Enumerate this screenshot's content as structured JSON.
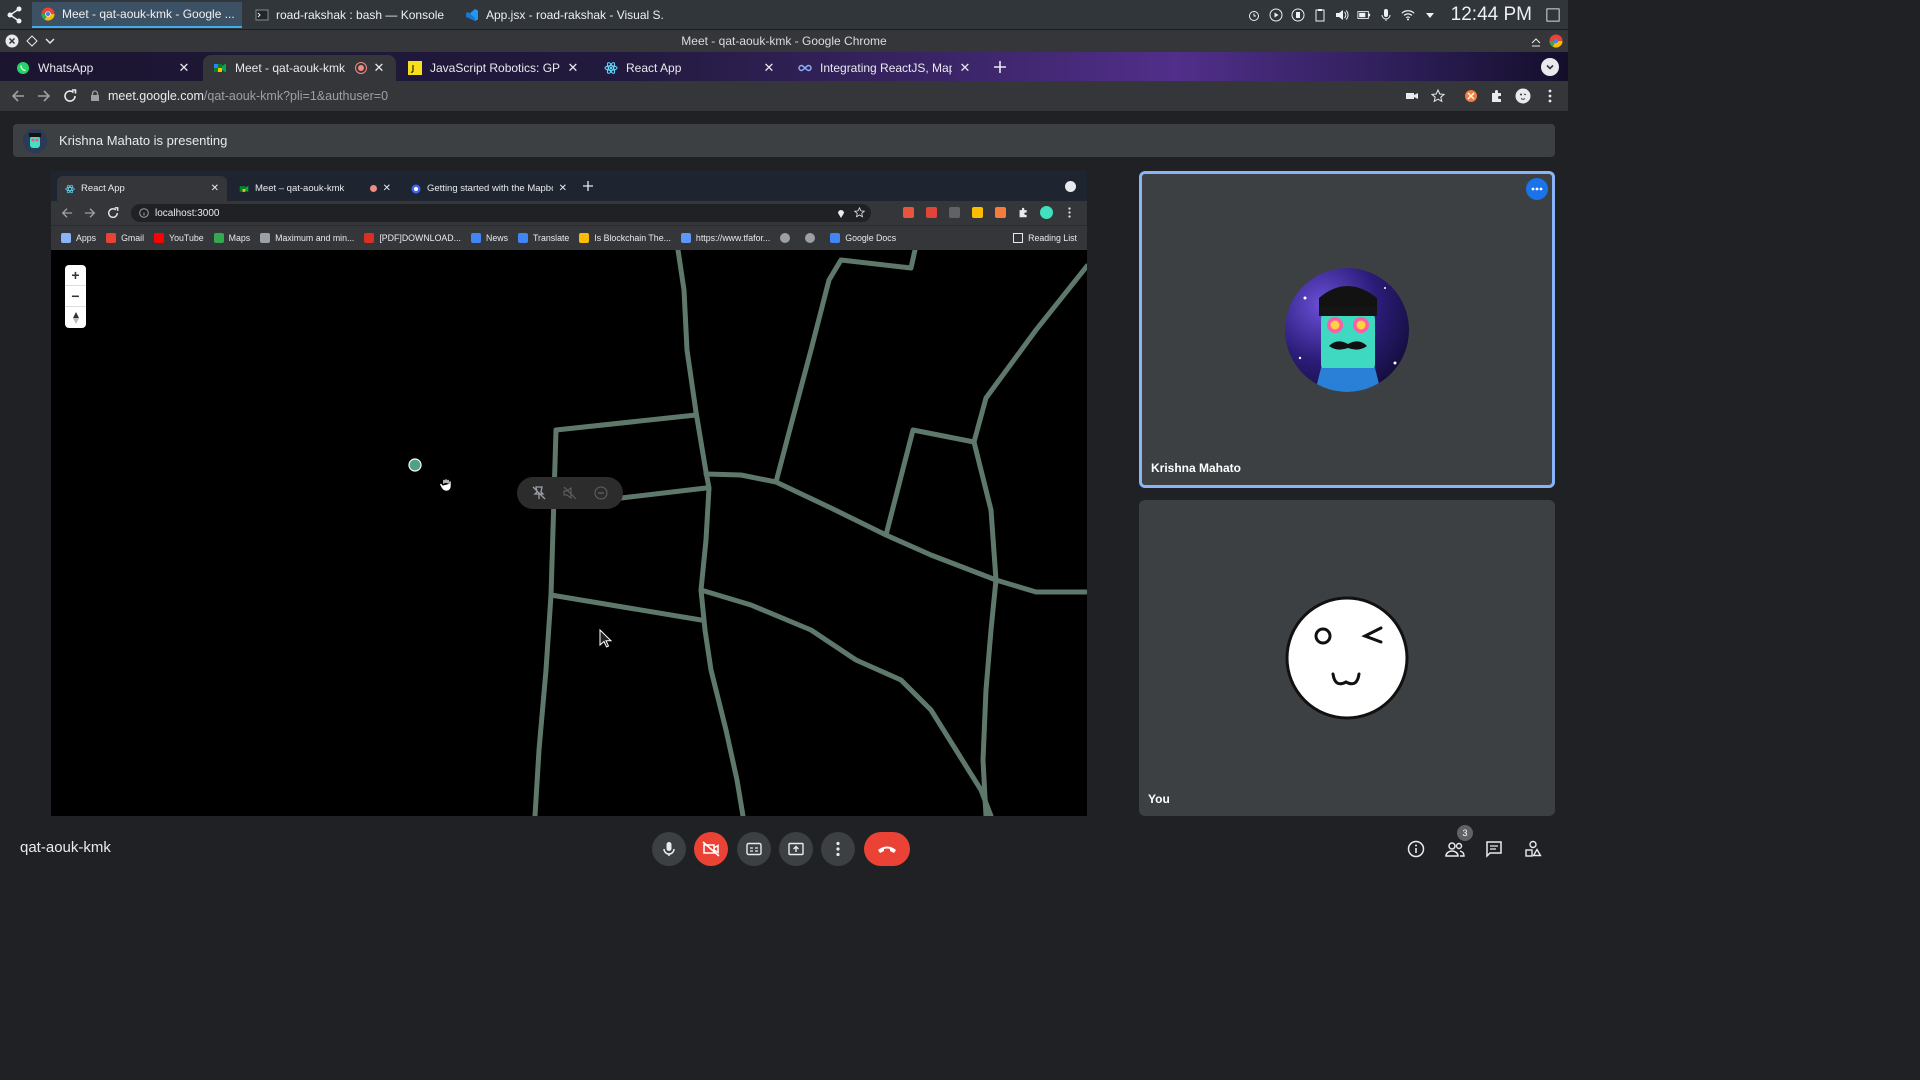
{
  "taskbar": {
    "tasks": [
      {
        "label": "Meet - qat-aouk-kmk - Google ...",
        "active": true
      },
      {
        "label": "road-rakshak : bash — Konsole",
        "active": false
      },
      {
        "label": "App.jsx - road-rakshak - Visual S...",
        "active": false
      }
    ],
    "clock": "12:44 PM"
  },
  "window": {
    "title": "Meet - qat-aouk-kmk - Google Chrome"
  },
  "tabs": [
    {
      "label": "WhatsApp"
    },
    {
      "label": "Meet - qat-aouk-kmk"
    },
    {
      "label": "JavaScript Robotics: GPS - Def"
    },
    {
      "label": "React App"
    },
    {
      "label": "Integrating ReactJS, Mapbox"
    }
  ],
  "address": {
    "host": "meet.google.com",
    "path": "/qat-aouk-kmk?pli=1&authuser=0"
  },
  "meet": {
    "presenting_banner": "Krishna Mahato is presenting",
    "meeting_code": "qat-aouk-kmk",
    "participants_count": "3",
    "tiles": [
      {
        "name": "Krishna Mahato"
      },
      {
        "name": "You"
      }
    ]
  },
  "presented": {
    "tabs": [
      {
        "label": "React App"
      },
      {
        "label": "Meet – qat-aouk-kmk"
      },
      {
        "label": "Getting started with the Mapbo"
      }
    ],
    "address": "localhost:3000",
    "bookmarks": [
      {
        "label": "Apps",
        "color": "#8ab4f8"
      },
      {
        "label": "Gmail",
        "color": "#ea4335"
      },
      {
        "label": "YouTube",
        "color": "#ff0000"
      },
      {
        "label": "Maps",
        "color": "#34a853"
      },
      {
        "label": "Maximum and min...",
        "color": "#9aa0a6"
      },
      {
        "label": "[PDF]DOWNLOAD...",
        "color": "#d93025"
      },
      {
        "label": "News",
        "color": "#4285f4"
      },
      {
        "label": "Translate",
        "color": "#4285f4"
      },
      {
        "label": "Is Blockchain The...",
        "color": "#fbbc04"
      },
      {
        "label": "https://www.tfafor...",
        "color": "#5e97f6"
      },
      {
        "label": "",
        "color": "#9aa0a6"
      },
      {
        "label": "",
        "color": "#9aa0a6"
      },
      {
        "label": "Google Docs",
        "color": "#4285f4"
      }
    ],
    "reading_list": "Reading List",
    "map": {
      "zoom_in": "+",
      "zoom_out": "−",
      "road_color": "#5f786c",
      "marker_color": "#4fa088"
    }
  }
}
